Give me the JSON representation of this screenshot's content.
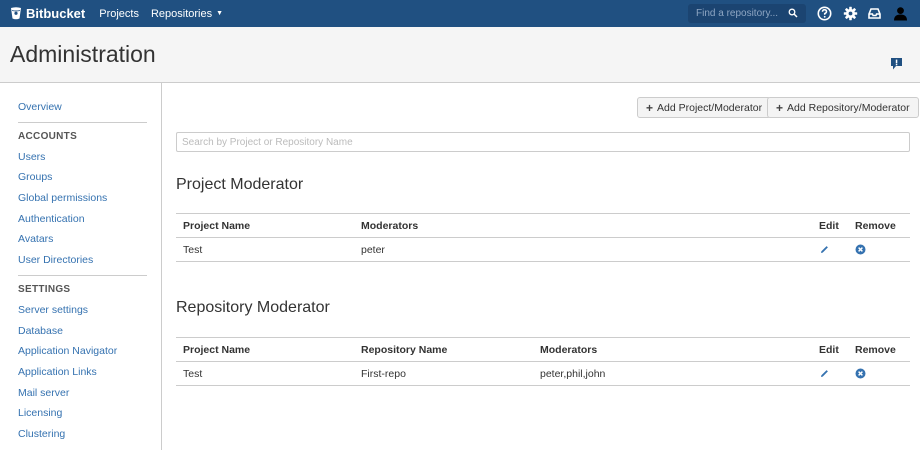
{
  "topbar": {
    "brand": "Bitbucket",
    "nav": [
      {
        "label": "Projects"
      },
      {
        "label": "Repositories",
        "has_dropdown": true
      }
    ],
    "search_placeholder": "Find a repository...",
    "icons": [
      "help-icon",
      "settings-icon",
      "inbox-icon",
      "user-icon"
    ]
  },
  "header": {
    "title": "Administration"
  },
  "sidebar": {
    "overview": "Overview",
    "accounts_heading": "ACCOUNTS",
    "accounts": [
      "Users",
      "Groups",
      "Global permissions",
      "Authentication",
      "Avatars",
      "User Directories"
    ],
    "settings_heading": "SETTINGS",
    "settings": [
      "Server settings",
      "Database",
      "Application Navigator",
      "Application Links",
      "Mail server",
      "Licensing",
      "Clustering"
    ]
  },
  "toolbar": {
    "add_project_label": "Add Project/Moderator",
    "add_repo_label": "Add Repository/Moderator"
  },
  "filter": {
    "placeholder": "Search by Project or Repository Name"
  },
  "project_section": {
    "title": "Project Moderator",
    "headers": {
      "project": "Project Name",
      "moderators": "Moderators",
      "edit": "Edit",
      "remove": "Remove"
    },
    "rows": [
      {
        "project": "Test",
        "moderators": "peter"
      }
    ]
  },
  "repo_section": {
    "title": "Repository Moderator",
    "headers": {
      "project": "Project Name",
      "repository": "Repository Name",
      "moderators": "Moderators",
      "edit": "Edit",
      "remove": "Remove"
    },
    "rows": [
      {
        "project": "Test",
        "repository": "First-repo",
        "moderators": "peter,phil,john"
      }
    ]
  },
  "colors": {
    "topbar": "#205081",
    "link": "#3572b0",
    "icon": "#3572b0"
  }
}
